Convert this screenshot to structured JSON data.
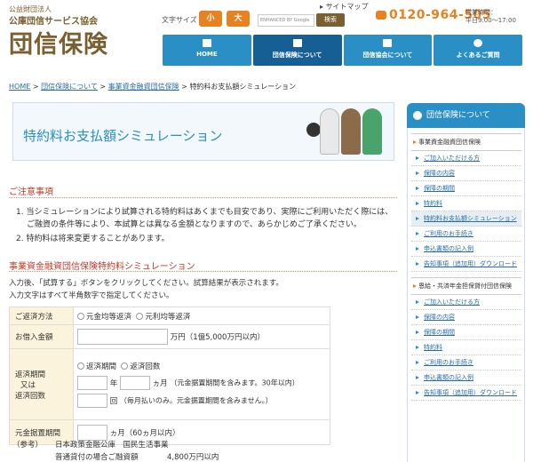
{
  "header": {
    "org_small": "公益財団法人",
    "org_name": "公庫団信サービス協会",
    "logo": "団信保険",
    "font_size_label": "文字サイズ",
    "font_small": "小",
    "font_large": "大",
    "search_placeholder": "ENHANCED BY Google",
    "search_button": "検索",
    "sitemap": "サイトマップ",
    "phone": "0120-964-505",
    "hours_line1": "営業時間：",
    "hours_line2": "平日9:00〜17:00"
  },
  "nav": [
    {
      "label": "HOME",
      "icon": "home-icon"
    },
    {
      "label": "団信保険について",
      "icon": "document-icon"
    },
    {
      "label": "団信協会について",
      "icon": "briefcase-icon"
    },
    {
      "label": "よくあるご質問",
      "icon": "question-icon"
    }
  ],
  "breadcrumb": [
    "HOME",
    "団信保険について",
    "事業資金融資団信保険",
    "特約料お支払額シミュレーション"
  ],
  "page_title": "特約料お支払額シミュレーション",
  "notice": {
    "heading": "ご注意事項",
    "items": [
      "1. 当シミュレーションにより試算される特約料はあくまでも目安であり、実際にご利用いただく際には、",
      "ご融資の条件等により、本試算とは異なる金額となりますので、あらかじめご了承ください。",
      "2. 特約料は将来変更することがあります。"
    ]
  },
  "sim": {
    "heading": "事業資金融資団信保険特約料シミュレーション",
    "lead1": "入力後、「試算する」ボタンをクリックしてください。試算結果が表示されます。",
    "lead2": "入力文字はすべて半角数字で指定してください。",
    "repay_method_label": "ご返済方法",
    "opt_equal_principal": "元金均等返済",
    "opt_equal_payment": "元利均等返済",
    "loan_label": "お借入金額",
    "loan_unit": "万円（1億5,000万円以内）",
    "period_label1": "返済期間",
    "period_label2": "又は",
    "period_label3": "返済回数",
    "opt_period": "返済期間",
    "opt_count": "返済回数",
    "year": "年",
    "month": "ヵ月",
    "period_note": "（元金据置期間を含みます。30年以内）",
    "times": "回",
    "times_note": "（毎月払いのみ。元金据置期間を含みません。）",
    "grace_label": "元金据置期間",
    "grace_unit": "ヵ月（60ヵ月以内）"
  },
  "reference": {
    "label": "（参考）",
    "org": "日本政策金融公庫　国民生活事業",
    "row_label": "普通貸付の場合ご融資額",
    "row_value": "4,800万円以内"
  },
  "sidebar": {
    "title": "団信保険について",
    "group1": "事業資金融資団信保険",
    "items1": [
      "ご加入いただける方",
      "保障の内容",
      "保障の期間",
      "特約料",
      "特約料お支払額シミュレーション",
      "ご利用のお手続き",
      "申込書類の記入例",
      "告知事項（追加用）ダウンロード"
    ],
    "group2": "恩給・共済年金担保貸付団信保険",
    "items2": [
      "ご加入いただける方",
      "保障の内容",
      "保障の期間",
      "特約料",
      "ご利用のお手続き",
      "申込書類の記入例",
      "告知事項（追加用）ダウンロード"
    ]
  },
  "colors": {
    "primary": "#2a8fc4",
    "nav_active": "#155f95",
    "accent": "#e8811f",
    "brand": "#7a6030",
    "heading_red": "#c0392b"
  }
}
